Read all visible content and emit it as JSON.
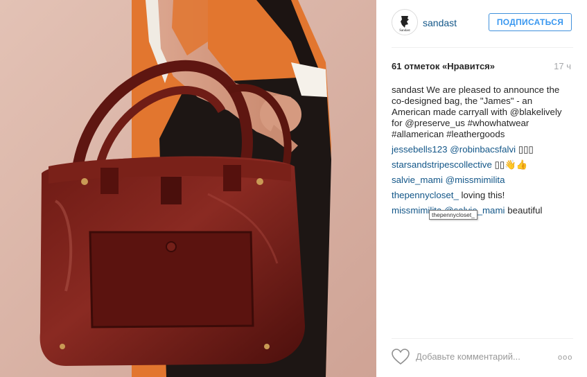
{
  "post": {
    "image_alt": "Burgundy leather handbag held by a woman",
    "username": "sandast",
    "follow_label": "ПОДПИСАТЬСЯ",
    "likes": "61 отметок «Нравится»",
    "time": "17 ч",
    "caption": {
      "user": "sandast",
      "parts": [
        {
          "text": " We are pleased to announce the co-designed bag, the \"James\" - an American made carryall with ",
          "type": "text"
        },
        {
          "text": "@blakelively",
          "type": "link"
        },
        {
          "text": " for ",
          "type": "text"
        },
        {
          "text": "@preserve_us",
          "type": "link"
        },
        {
          "text": " ",
          "type": "text"
        },
        {
          "text": "#whowhatwear",
          "type": "link"
        },
        {
          "text": " ",
          "type": "text"
        },
        {
          "text": "#allamerican",
          "type": "link"
        },
        {
          "text": " ",
          "type": "text"
        },
        {
          "text": "#leathergoods",
          "type": "link"
        }
      ]
    },
    "comments": [
      {
        "user": "jessebells123",
        "mention": "@robinbacsfalvi",
        "text": " ▯▯▯"
      },
      {
        "user": "starsandstripescollective",
        "mention": "",
        "text": " ▯▯👋👍"
      },
      {
        "user": "salvie_mami",
        "mention": "@missmimilita",
        "text": ""
      },
      {
        "user": "thepennycloset_",
        "mention": "",
        "text": " loving this!"
      },
      {
        "user": "missmimilita",
        "mention": "@salvie_mami",
        "text": " beautiful"
      }
    ],
    "tooltip": "thepennycloset_",
    "add_comment_placeholder": "Добавьте комментарий...",
    "more_label": "ooo"
  }
}
